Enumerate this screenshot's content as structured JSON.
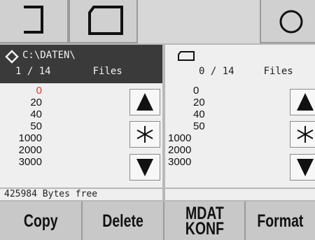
{
  "toolbar": {
    "buttons": [
      {
        "icon": "exit-bracket-icon"
      },
      {
        "icon": "card-icon"
      },
      {
        "icon": "circle-icon"
      }
    ]
  },
  "left_panel": {
    "icon": "diamond-arrow-icon",
    "path": "C:\\DATEN\\",
    "count": "1 / 14",
    "files_label": "Files",
    "items": [
      "0",
      "20",
      "40",
      "50",
      "1000",
      "2000",
      "3000"
    ],
    "selected_index": 0,
    "highlight_color": "#e03a2f",
    "free_text": "425984 Bytes free"
  },
  "right_panel": {
    "icon": "card-icon",
    "count": "0 / 14",
    "files_label": "Files",
    "items": [
      "0",
      "20",
      "40",
      "50",
      "1000",
      "2000",
      "3000"
    ]
  },
  "scroll_buttons": {
    "up_icon": "triangle-up-icon",
    "mid_icon": "asterisk-icon",
    "down_icon": "triangle-down-icon"
  },
  "bottom_bar": {
    "copy": "Copy",
    "delete": "Delete",
    "mdat_line1": "MDAT",
    "mdat_line2": "KONF",
    "format": "Format"
  }
}
